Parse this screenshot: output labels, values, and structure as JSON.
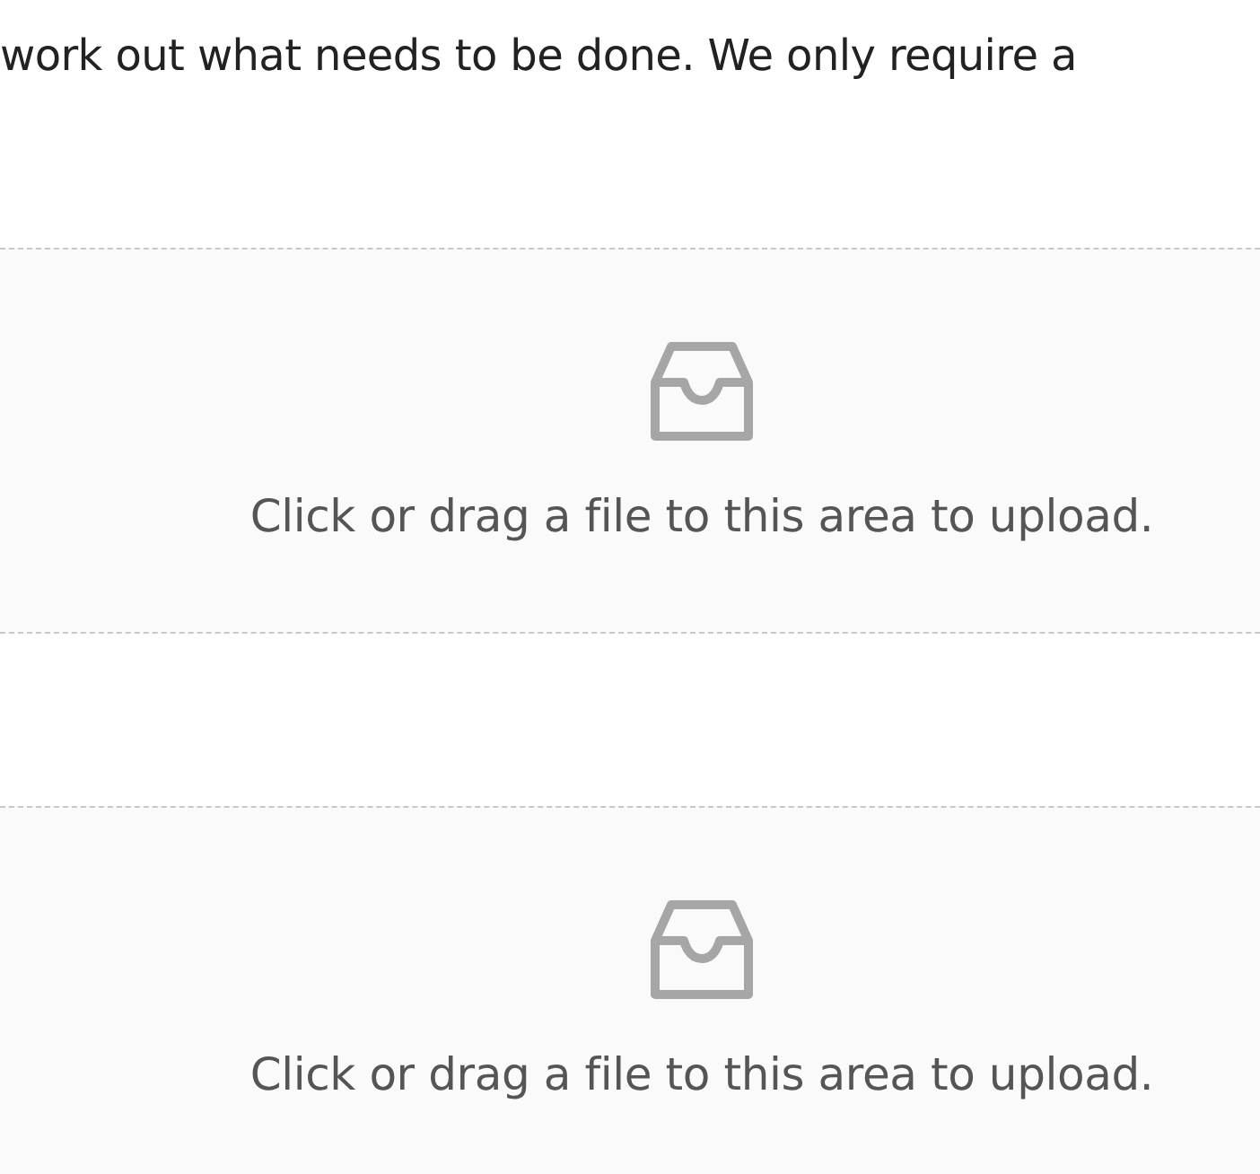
{
  "intro": "work out what needs to be done. We only require a",
  "upload_zones": [
    {
      "prompt": "Click or drag a file to this area to upload."
    },
    {
      "prompt": "Click or drag a file to this area to upload."
    }
  ]
}
